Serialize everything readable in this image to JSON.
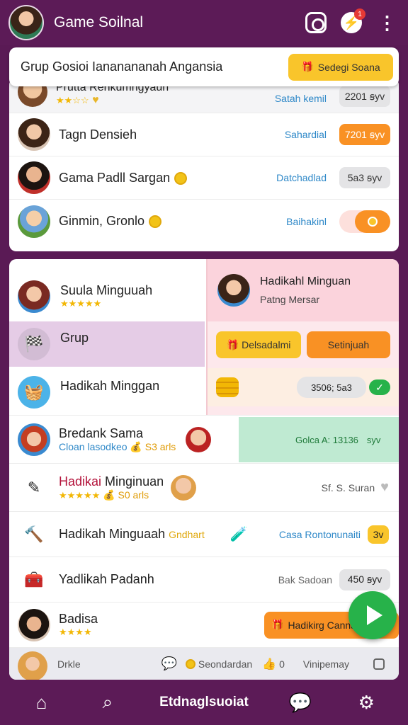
{
  "app": {
    "title": "Game Soilnal",
    "notif_count": "1"
  },
  "banner": {
    "text": "Grup Gosioi Iananananah Angansia",
    "button": "Sedegi Soana"
  },
  "top_list": [
    {
      "name": "Prutta Renkumngyaun",
      "stars": "★★☆☆",
      "status": "Satah kemil",
      "value": "2201 ꞩyv"
    },
    {
      "name": "Tagn Densieh",
      "status": "Sahardial",
      "value": "7201 ꞩyv"
    },
    {
      "name": "Gama Padll Sargan",
      "status": "Datchadlad",
      "value": "5a3 ꞩyv"
    },
    {
      "name": "Ginmin, Gronlo",
      "status": "Baihakinl"
    }
  ],
  "menu": [
    {
      "label": "Suula Minguuah",
      "stars": "★★★★★"
    },
    {
      "label": "Grup"
    },
    {
      "label": "Hadikah Minggan"
    }
  ],
  "panel": {
    "title": "Hadikahl Minguan",
    "subtitle": "Patng Mersar",
    "btn1": "Delsadalmi",
    "btn2": "Setinjuah",
    "amount": "3506; 5a3"
  },
  "rows": [
    {
      "title": "Bredank Sama",
      "sub": "Cloan lasodkeo",
      "tag": "S3 arls",
      "status": "Golca A: 13136",
      "status_suffix": "syv"
    },
    {
      "title_a": "Hadikai",
      "title_b": "Minginuan",
      "stars": "★★★★★",
      "tag": "S0 arls",
      "status": "Sf. S. Suran"
    },
    {
      "title": "Hadikah Minguaah",
      "extra": "Gndhart",
      "status": "Casa Rontonunaiti",
      "value": "3v"
    },
    {
      "title": "Yadlikah Padanh",
      "status": "Bak Sadoan",
      "value": "450 ꞩyv"
    },
    {
      "title": "Badisa",
      "stars": "★★★★",
      "button": "Hadikirg Cannah"
    }
  ],
  "footer_row": {
    "label": "Drkle",
    "a": "Seondardan",
    "b": "0",
    "c": "Vinipemay"
  },
  "bottom_nav": {
    "label": "Etdnaglsuoiat"
  },
  "colors": {
    "header": "#5c1b57",
    "yellow": "#f9c52b",
    "orange": "#f99124",
    "green": "#27b24a",
    "pink": "#fbd3dc",
    "highlight": "#e5cce6"
  }
}
